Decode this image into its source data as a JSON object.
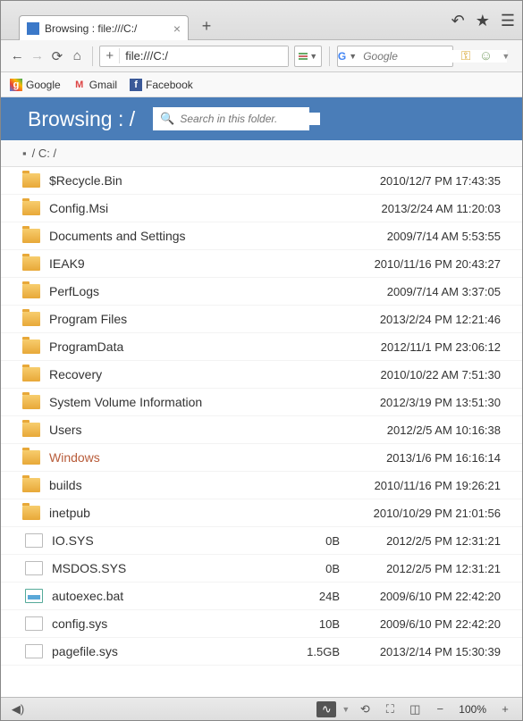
{
  "tab": {
    "title": "Browsing : file:///C:/"
  },
  "url": {
    "value": "file:///C:/"
  },
  "search": {
    "placeholder": "Google",
    "engine_label": "g"
  },
  "bookmarks": [
    {
      "label": "Google"
    },
    {
      "label": "Gmail"
    },
    {
      "label": "Facebook"
    }
  ],
  "header": {
    "title": "Browsing : /",
    "search_placeholder": "Search in this folder."
  },
  "breadcrumb": {
    "path": "/ C: /"
  },
  "items": [
    {
      "type": "folder",
      "name": "$Recycle.Bin",
      "size": "",
      "date": "2010/12/7 PM 17:43:35"
    },
    {
      "type": "folder",
      "name": "Config.Msi",
      "size": "",
      "date": "2013/2/24 AM 11:20:03"
    },
    {
      "type": "folder",
      "name": "Documents and Settings",
      "size": "",
      "date": "2009/7/14 AM 5:53:55"
    },
    {
      "type": "folder",
      "name": "IEAK9",
      "size": "",
      "date": "2010/11/16 PM 20:43:27"
    },
    {
      "type": "folder",
      "name": "PerfLogs",
      "size": "",
      "date": "2009/7/14 AM 3:37:05"
    },
    {
      "type": "folder",
      "name": "Program Files",
      "size": "",
      "date": "2013/2/24 PM 12:21:46"
    },
    {
      "type": "folder",
      "name": "ProgramData",
      "size": "",
      "date": "2012/11/1 PM 23:06:12"
    },
    {
      "type": "folder",
      "name": "Recovery",
      "size": "",
      "date": "2010/10/22 AM 7:51:30"
    },
    {
      "type": "folder",
      "name": "System Volume Information",
      "size": "",
      "date": "2012/3/19 PM 13:51:30"
    },
    {
      "type": "folder",
      "name": "Users",
      "size": "",
      "date": "2012/2/5 AM 10:16:38"
    },
    {
      "type": "folder",
      "name": "Windows",
      "highlight": true,
      "size": "",
      "date": "2013/1/6 PM 16:16:14"
    },
    {
      "type": "folder",
      "name": "builds",
      "size": "",
      "date": "2010/11/16 PM 19:26:21"
    },
    {
      "type": "folder",
      "name": "inetpub",
      "size": "",
      "date": "2010/10/29 PM 21:01:56"
    },
    {
      "type": "file",
      "name": "IO.SYS",
      "size": "0B",
      "date": "2012/2/5 PM 12:31:21"
    },
    {
      "type": "file",
      "name": "MSDOS.SYS",
      "size": "0B",
      "date": "2012/2/5 PM 12:31:21"
    },
    {
      "type": "bat",
      "name": "autoexec.bat",
      "size": "24B",
      "date": "2009/6/10 PM 22:42:20"
    },
    {
      "type": "file",
      "name": "config.sys",
      "size": "10B",
      "date": "2009/6/10 PM 22:42:20"
    },
    {
      "type": "file",
      "name": "pagefile.sys",
      "size": "1.5GB",
      "date": "2013/2/14 PM 15:30:39"
    }
  ],
  "status": {
    "zoom": "100%"
  }
}
